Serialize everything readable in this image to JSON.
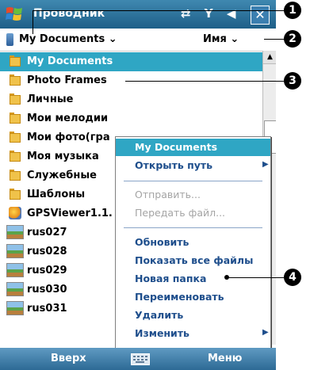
{
  "app": {
    "title": "Проводник",
    "status_icons": "⇄ Y ◀"
  },
  "folder_bar": {
    "current_folder": "My Documents ⌄",
    "sort": "Имя ⌄"
  },
  "file_list": [
    {
      "label": "My Documents",
      "type": "folder-up",
      "selected": true
    },
    {
      "label": "Photo Frames",
      "type": "folder"
    },
    {
      "label": "Личные",
      "type": "folder"
    },
    {
      "label": "Мои мелодии",
      "type": "folder"
    },
    {
      "label": "Мои фото(гра",
      "type": "folder"
    },
    {
      "label": "Моя музыка",
      "type": "folder"
    },
    {
      "label": "Служебные",
      "type": "folder"
    },
    {
      "label": "Шаблоны",
      "type": "folder"
    },
    {
      "label": "GPSViewer1.1.",
      "type": "app"
    },
    {
      "label": "rus027",
      "type": "image"
    },
    {
      "label": "rus028",
      "type": "image"
    },
    {
      "label": "rus029",
      "type": "image"
    },
    {
      "label": "rus030",
      "type": "image"
    },
    {
      "label": "rus031",
      "type": "image"
    }
  ],
  "context_menu": {
    "header": "My Documents",
    "items": [
      {
        "label": "Открыть путь",
        "submenu": true
      },
      {
        "label": "Отправить...",
        "disabled": true
      },
      {
        "label": "Передать файл...",
        "disabled": true
      },
      {
        "label": "Обновить"
      },
      {
        "label": "Показать все файлы"
      },
      {
        "label": "Новая папка"
      },
      {
        "label": "Переименовать"
      },
      {
        "label": "Удалить"
      },
      {
        "label": "Изменить",
        "submenu": true
      }
    ]
  },
  "bottom_bar": {
    "left": "Вверх",
    "right": "Меню"
  },
  "callouts": [
    "1",
    "2",
    "3",
    "4"
  ],
  "colors": {
    "accent": "#2fa6c4",
    "titlebar": "#2a6f98",
    "menu_text": "#1e4e8c"
  }
}
